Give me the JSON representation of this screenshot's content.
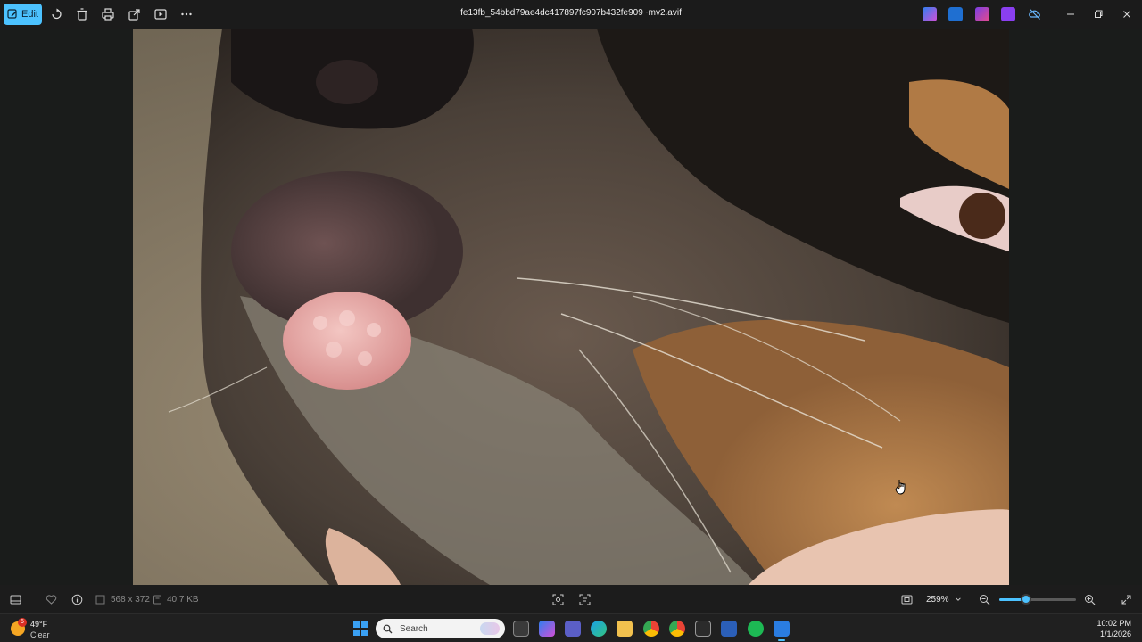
{
  "titlebar": {
    "filename": "fe13fb_54bbd79ae4dc417897fc907b432fe909~mv2.avif",
    "edit_label": "Edit"
  },
  "toolbar": {
    "icons": [
      "rotate-icon",
      "delete-icon",
      "print-icon",
      "share-icon",
      "slideshow-icon",
      "more-icon"
    ]
  },
  "viewer_bar": {
    "dimensions": "568 x 372",
    "file_size": "40.7 KB",
    "zoom": "259%",
    "zoom_fraction": 0.35
  },
  "taskbar": {
    "weather_temp": "49°F",
    "weather_condition": "Clear",
    "weather_badge": "5",
    "search_placeholder": "Search",
    "time": "10:02 PM",
    "date": "1/1/2026"
  },
  "colors": {
    "accent": "#4cc2ff",
    "background": "#1b1b1b"
  }
}
